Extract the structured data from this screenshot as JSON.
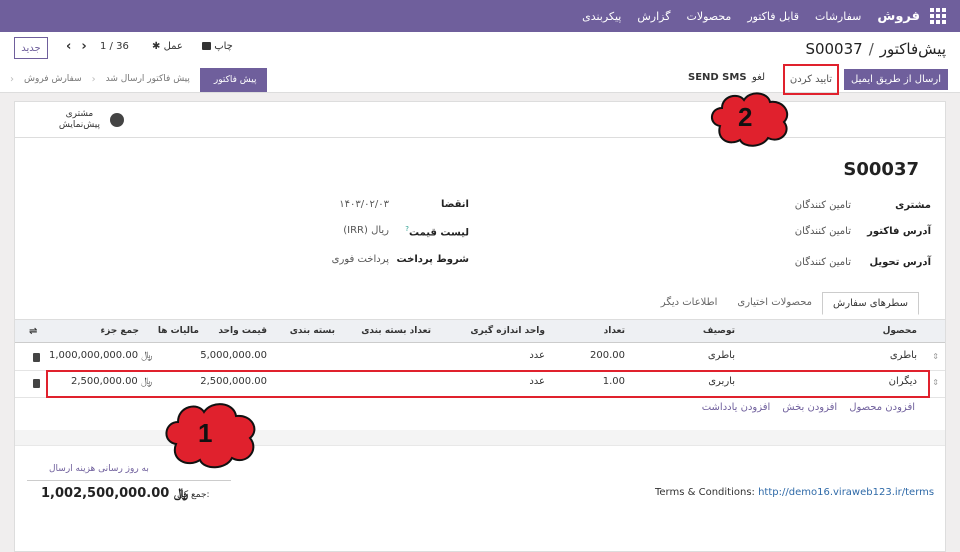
{
  "navbar": {
    "brand": "فروش",
    "menu": [
      "سفارشات",
      "قابل فاکتور",
      "محصولات",
      "گزارش",
      "پیکربندی"
    ]
  },
  "control_panel": {
    "breadcrumb_parent": "پیش‌فاکتور",
    "breadcrumb_sep": "/",
    "breadcrumb_current": "S00037",
    "new_label": "جدید",
    "pager": "1 / 36",
    "action_label": "عمل",
    "print_label": "چاپ"
  },
  "status_bar": {
    "send_email": "ارسال از طریق ایمیل",
    "confirm": "تایید کردن",
    "cancel": "لغو",
    "send_sms": "SEND SMS",
    "stages": [
      "پیش فاکتور",
      "پیش فاکتور ارسال شد",
      "سفارش فروش"
    ],
    "active_stage": "پیش فاکتور"
  },
  "smart_button": {
    "line1": "مشتری",
    "line2": "پیش‌نمایش"
  },
  "record": {
    "name": "S00037",
    "customer_label": "مشتری",
    "customer_value": "تامین کنندگان",
    "invoice_address_label": "آدرس فاکتور",
    "invoice_address_value": "تامین کنندگان",
    "delivery_address_label": "آدرس تحویل",
    "delivery_address_value": "تامین کنندگان",
    "expiration_label": "انقضا",
    "expiration_value": "۱۴۰۳/۰۲/۰۳",
    "pricelist_label": "لیست قیمت",
    "pricelist_help": "?",
    "pricelist_value": "ریال (IRR)",
    "payment_terms_label": "شروط پرداخت",
    "payment_terms_value": "پرداخت فوری"
  },
  "tabs": [
    "سطرهای سفارش",
    "محصولات اختیاری",
    "اطلاعات دیگر"
  ],
  "table": {
    "headers": {
      "product": "محصول",
      "description": "توصیف",
      "quantity": "تعداد",
      "uom": "واحد اندازه گیری",
      "packaging_qty": "تعداد بسته بندی",
      "packaging": "بسته بندی",
      "unit_price": "قیمت واحد",
      "taxes": "مالیات ها",
      "subtotal": "جمع جزء"
    },
    "rows": [
      {
        "product": "باطری",
        "description": "باطری",
        "quantity": "200.00",
        "uom": "عدد",
        "unit_price": "5,000,000.00",
        "subtotal": "﷼ 1,000,000,000.00"
      },
      {
        "product": "دیگران",
        "description": "باربری",
        "quantity": "1.00",
        "uom": "عدد",
        "unit_price": "2,500,000.00",
        "subtotal": "﷼ 2,500,000.00"
      }
    ],
    "add_links": [
      "افزودن محصول",
      "افزودن بخش",
      "افزودن یادداشت"
    ]
  },
  "footer": {
    "terms_label": "Terms & Conditions:",
    "terms_link": "http://demo16.viraweb123.ir/terms",
    "update_shipping": "به روز رسانی هزینه ارسال",
    "total_label": "جمع کل:",
    "total_value": "﷼ 1,002,500,000.00"
  },
  "callouts": {
    "one": "1",
    "two": "2"
  },
  "colors": {
    "brand": "#6f5f9c",
    "highlight": "#e0212d"
  }
}
